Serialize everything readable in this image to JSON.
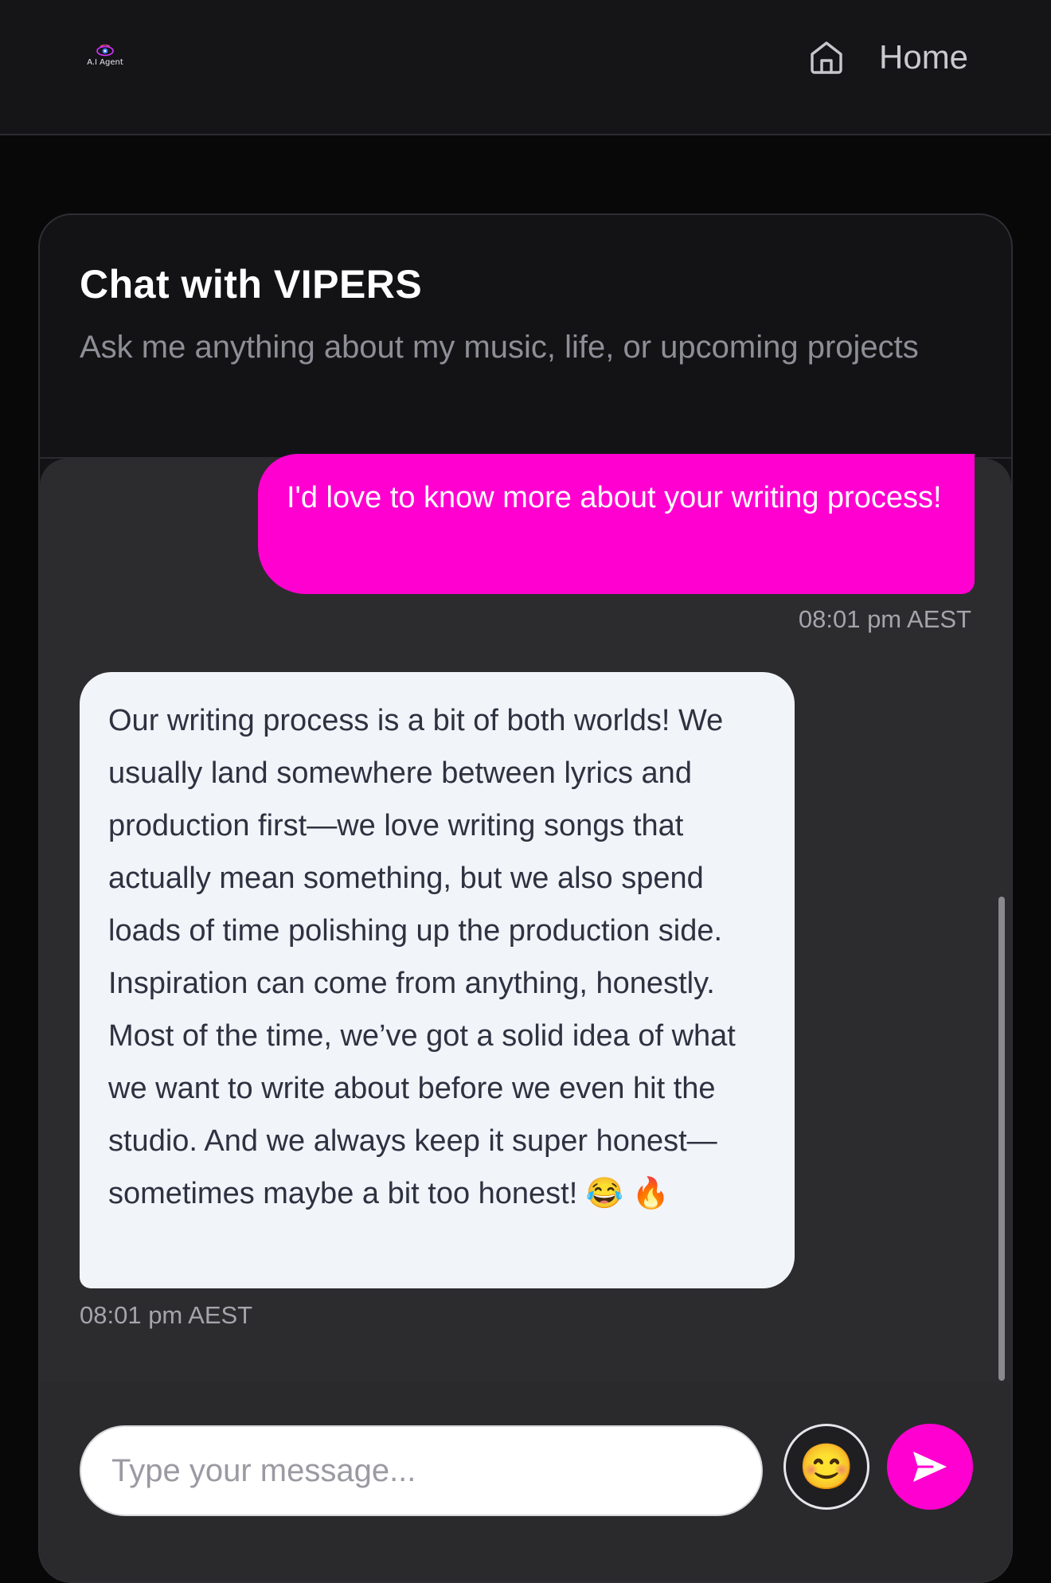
{
  "brand": {
    "logo_text": "A.I Agent"
  },
  "nav": {
    "home_icon": "home-icon",
    "home_label": "Home"
  },
  "chat": {
    "title": "Chat with VIPERS",
    "subtitle": "Ask me anything about my music, life, or upcoming projects",
    "messages": [
      {
        "sender": "user",
        "text": "I'd love to know more about your writing process!",
        "timestamp": "08:01 pm AEST"
      },
      {
        "sender": "agent",
        "text": "Our writing process is a bit of both worlds! We usually land somewhere between lyrics and production first—we love writing songs that actually mean something, but we also spend loads of time polishing up the production side. Inspiration can come from anything, honestly. Most of the time, we’ve got a solid idea of what we want to write about before we even hit the studio. And we always keep it super honest—sometimes maybe a bit too honest! 😂 🔥",
        "timestamp": "08:01 pm AEST"
      }
    ]
  },
  "composer": {
    "placeholder": "Type your message...",
    "value": "",
    "emoji_icon": "😊",
    "send_icon": "send-icon"
  },
  "colors": {
    "accent": "#ff00d0",
    "page_background": "#080809",
    "header_background": "#151518",
    "card_background": "#131316",
    "messages_background": "#2c2c2e",
    "agent_bubble": "#f1f4f9"
  }
}
